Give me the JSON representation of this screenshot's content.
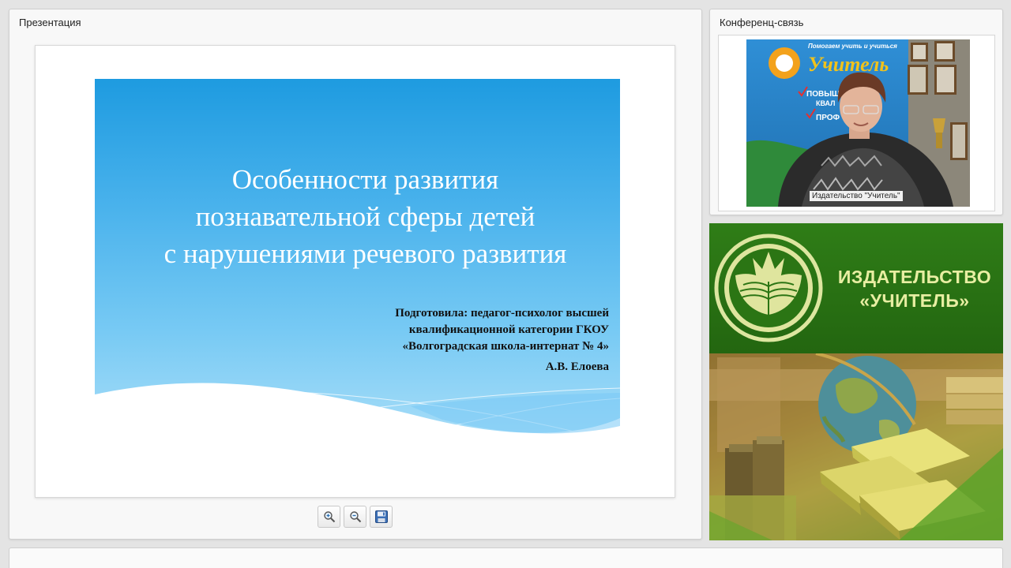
{
  "presentation_panel": {
    "title": "Презентация",
    "slide": {
      "title_lines": [
        "Особенности развития",
        "познавательной сферы детей",
        "с нарушениями речевого развития"
      ],
      "author_lines": [
        "Подготовила: педагог-психолог высшей",
        "квалификационной категории ГКОУ",
        "«Волгоградская школа-интернат № 4»"
      ],
      "author_name": "А.В. Елоева"
    },
    "toolbar": {
      "zoom_in_icon": "zoom-in-icon",
      "zoom_out_icon": "zoom-out-icon",
      "save_icon": "floppy-disk-icon"
    }
  },
  "conference_panel": {
    "title": "Конференц-связь",
    "video_label": "Издательство \"Учитель\"",
    "poster_text": [
      "Помогаем учить и учиться",
      "Учитель",
      "ПОВЫШЕ",
      "КВАЛ",
      "ПРОФ"
    ]
  },
  "banner": {
    "name_lines": [
      "ИЗДАТЕЛЬСТВО",
      "«УЧИТЕЛЬ»"
    ]
  },
  "colors": {
    "slide_blue": "#1e9be0",
    "banner_green": "#2f7d17",
    "banner_text": "#e8eea2"
  }
}
